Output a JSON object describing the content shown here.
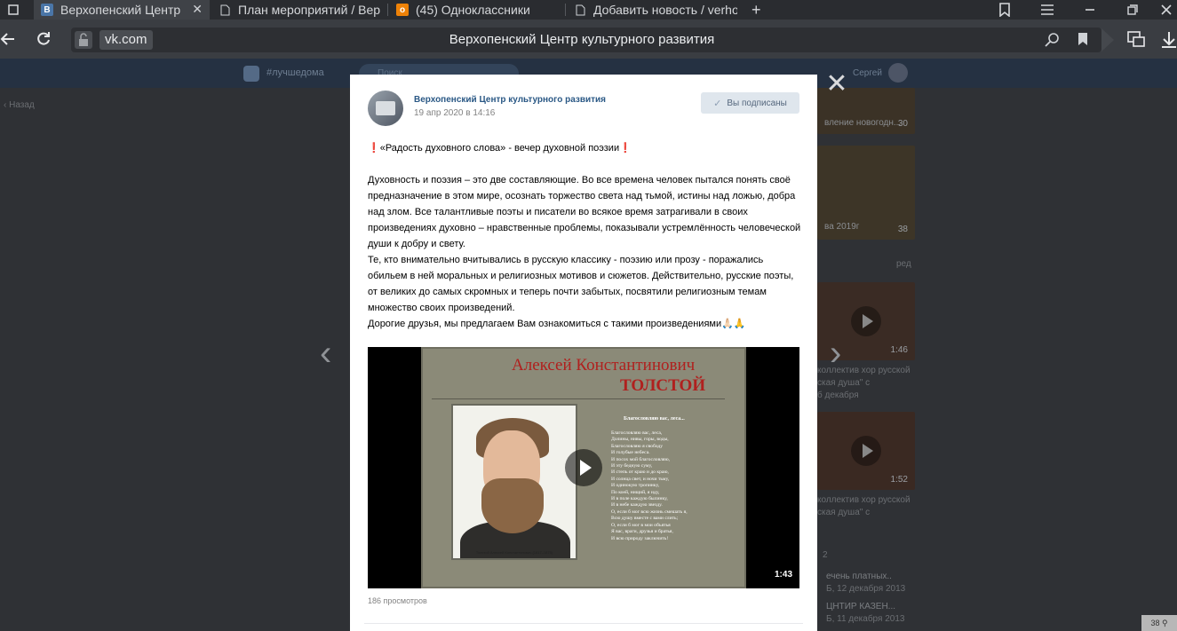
{
  "browser": {
    "tabs": [
      {
        "label": "Верхопенский Центр культурного развития",
        "active": true
      },
      {
        "label": "План мероприятий / Верхопенский Центр"
      },
      {
        "label": "(45) Одноклассники"
      },
      {
        "label": "Добавить новость / verhopen"
      }
    ],
    "new_tab": "+",
    "url_domain": "vk.com",
    "page_title": "Верхопенский Центр культурного развития"
  },
  "page": {
    "hashtag": "#лучшедома",
    "search_placeholder": "Поиск",
    "user_name": "Сергей",
    "back_link": "Назад"
  },
  "side": {
    "items": [
      {
        "caption": "вление новогодн...",
        "count": "30"
      },
      {
        "caption": "ва 2019г",
        "count": "38"
      },
      {
        "caption": "коллектив хор русской",
        "caption2": "ская душа\" с",
        "date": "б декабря",
        "dur": "1:46"
      },
      {
        "caption": "коллектив хор русской",
        "caption2": "ская душа\" с",
        "dur": "1:52"
      }
    ],
    "red_label": "ред",
    "link1": "ечень платных..",
    "date1": "Б, 12 декабря 2013",
    "link2": "ЦНТИР КАЗЕН...",
    "date2": "Б, 11 декабря 2013",
    "num2": "2"
  },
  "post": {
    "group_name": "Верхопенский Центр культурного развития",
    "date": "19 апр 2020 в 14:16",
    "subscribed_label": "Вы подписаны",
    "title_line": "«Радость духовного слова» - вечер духовной поэзии",
    "paragraphs": [
      "Духовность и поэзия – это две составляющие. Во все времена человек пытался понять своё предназначение в этом мире, осознать торжество света над тьмой, истины над ложью, добра над злом. Все талантливые поэты и писатели во всякое время затрагивали в своих произведениях духовно – нравственные проблемы, показывали устремлённость человеческой души к добру и свету.",
      "Те, кто внимательно вчитывались в русскую классику - поэзию или прозу - поражались обильем в ней моральных и религиозных мотивов и сюжетов. Действительно, русские поэты, от великих до самых скромных и теперь почти забытых, посвятили религиозным темам множество своих произведений.",
      "Дорогие друзья, мы предлагаем Вам ознакомиться с такими произведениями🙏🏻🙏"
    ],
    "video": {
      "title_line1": "Алексей Константинович",
      "title_line2": "ТОЛСТОЙ",
      "portrait_caption": "Толстой Алексей Константинович (1817–1875)",
      "poem_title": "Благословляю вас, леса...",
      "poem_lines": [
        "Благословляю вас, леса,",
        "Долины, нивы, горы, воды,",
        "Благословляю я свободу",
        "И голубые небеса.",
        "И посох мой благословляю,",
        "И эту бедную суму,",
        "И степь от краю и до краю,",
        "И солнца свет, и ночи тьму,",
        "И одинокую тропинку,",
        "По коей, нищий, я иду,",
        "И в поле каждую былинку,",
        "И в небе каждую звезду.",
        "О, если б мог всю жизнь смешать я,",
        "Всю душу вместе с вами слить;",
        "О, если б мог в мои объятья",
        "Я вас, враги, друзья и братья,",
        "И всю природу заключить!"
      ],
      "duration": "1:43"
    },
    "views": "186 просмотров"
  },
  "counter": "38"
}
